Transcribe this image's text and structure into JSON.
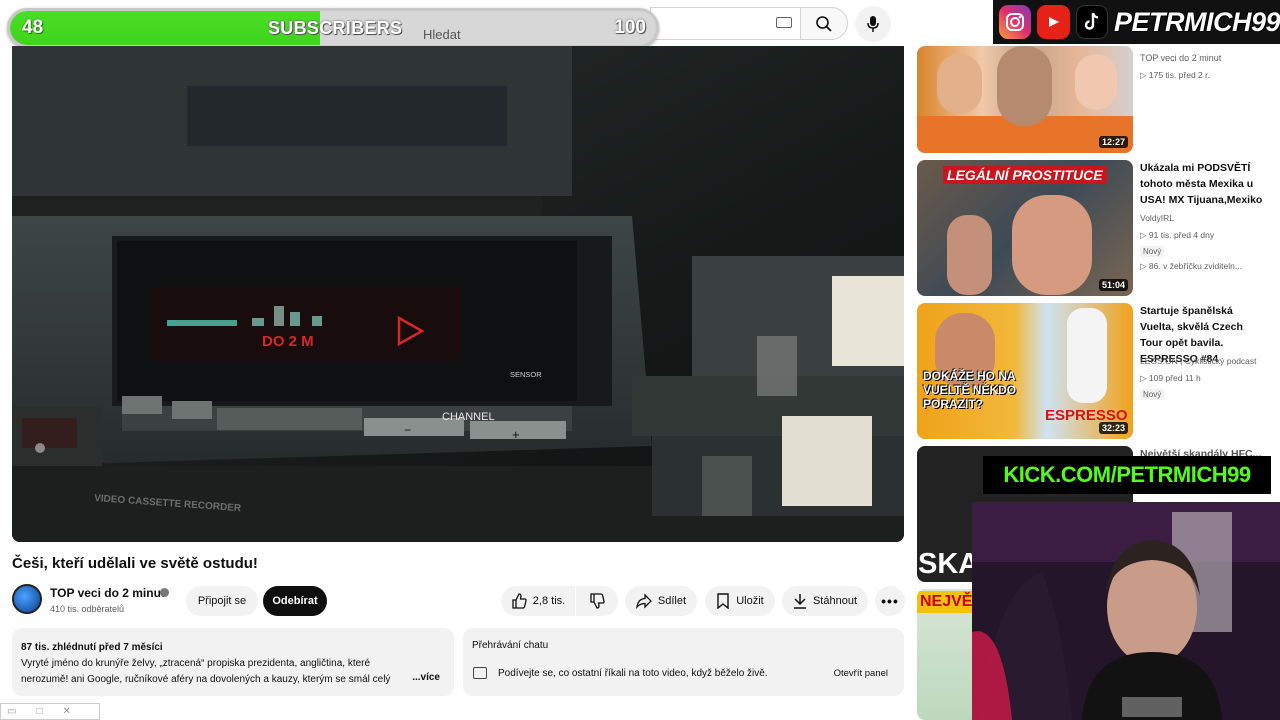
{
  "sub_goal": {
    "current": "48",
    "label": "SUBSCRIBERS",
    "goal": "100",
    "progress_fraction": 0.48
  },
  "search": {
    "placeholder": "Hledat"
  },
  "social": {
    "handle": "PETRMICH99",
    "icons": [
      "instagram-icon",
      "youtube-icon",
      "tiktok-icon"
    ]
  },
  "player": {
    "display_text": "DO 2 M",
    "channel_label": "CHANNEL",
    "sensor_label": "SENSOR",
    "recorder_label": "VIDEO CASSETTE RECORDER",
    "minus": "−",
    "plus": "+"
  },
  "video": {
    "title": "Češi, kteří udělali ve světě ostudu!",
    "channel": "TOP veci do 2 minut",
    "subscribers": "410 tis. odběratelů",
    "join_label": "Připojit se",
    "subscribe_label": "Odebírat",
    "likes": "2,8 tis.",
    "share_label": "Sdílet",
    "save_label": "Uložit",
    "download_label": "Stáhnout",
    "more_label": "•••"
  },
  "description": {
    "stats": "87 tis. zhlédnutí  před 7 měsíci",
    "text": "Vyryté jméno do krunýře želvy, „ztracená“ propiska prezidenta, angličtina, které nerozumě! ani Google, ručníkové aféry na dovolených a kauzy, kterým se smál celý svět. Že se Č",
    "more": "...více"
  },
  "chat": {
    "title": "Přehrávání chatu",
    "text": "Podívejte se, co ostatní říkali na toto video, když běželo živě.",
    "open": "Otevřít panel"
  },
  "recommendations": [
    {
      "title": "",
      "channel": "TOP veci do 2 minut",
      "meta": "▷ 175 tis.   před 2 r.",
      "badge": "",
      "extra": "",
      "duration": "12:27",
      "thumb_text": ""
    },
    {
      "title": "Ukázala mi PODSVĚTÍ tohoto města Mexika u USA! MX Tijuana,Mexiko",
      "channel": "VoldyIRL",
      "meta": "▷ 91 tis.   před 4 dny",
      "badge": "Nový",
      "extra": "▷ 86. v žebříčku zviditeln...",
      "duration": "51:04",
      "thumb_text": "LEGÁLNÍ PROSTITUCE"
    },
    {
      "title": "Startuje španělská Vuelta, skvělá Czech Tour opět bavila. ESPRESSO #84",
      "channel": "LEGS:ON | Cyklistický podcast",
      "meta": "▷ 109   před 11 h",
      "badge": "Nový",
      "extra": "",
      "duration": "32:23",
      "thumb_text": "DOKÁŽE HO NA VUELTĚ NĚKDO PORAZIT?",
      "thumb_text2": "ESPRESSO"
    },
    {
      "title": "Největší skandály HFC...",
      "channel": "",
      "meta": "",
      "badge": "",
      "extra": "",
      "duration": "",
      "thumb_text": "SKA"
    },
    {
      "title": "",
      "channel": "",
      "meta": "",
      "badge": "",
      "extra": "",
      "duration": "",
      "thumb_text": "NEJVĚTŠ"
    }
  ],
  "kick": {
    "text": "KICK.COM/PETRMICH99"
  },
  "colors": {
    "accent_green": "#53fc18",
    "progress_green": "#4ade27",
    "youtube_red": "#e62117"
  }
}
